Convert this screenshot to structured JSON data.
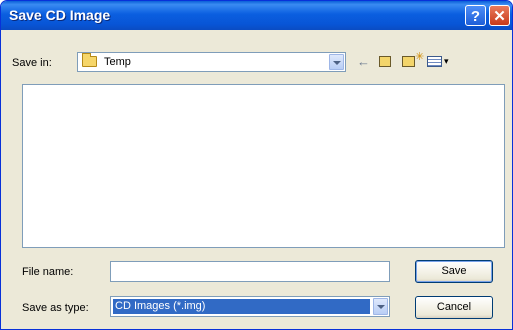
{
  "window": {
    "title": "Save CD Image"
  },
  "save_in": {
    "label": "Save in:",
    "value": "Temp"
  },
  "toolbar": [
    "back-icon",
    "up-folder-icon",
    "new-folder-icon",
    "views-menu-icon"
  ],
  "file_name": {
    "label": "File name:",
    "value": ""
  },
  "save_as_type": {
    "label": "Save as type:",
    "value": "CD Images (*.img)"
  },
  "buttons": {
    "save": "Save",
    "cancel": "Cancel"
  }
}
